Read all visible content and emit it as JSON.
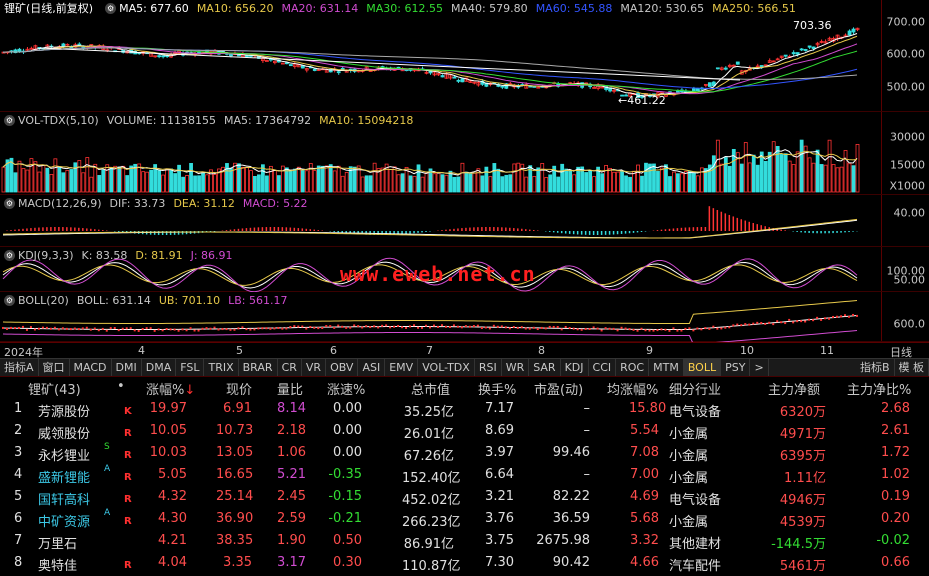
{
  "stock_title": "锂矿(日线,前复权)",
  "ma_legend": [
    {
      "label": "MA5: 677.60",
      "color": "#ffffff"
    },
    {
      "label": "MA10: 656.20",
      "color": "#e6c84a"
    },
    {
      "label": "MA20: 631.14",
      "color": "#d04cd0"
    },
    {
      "label": "MA30: 612.55",
      "color": "#33dd33"
    },
    {
      "label": "MA40: 579.80",
      "color": "#c8c8c8"
    },
    {
      "label": "MA60: 545.88",
      "color": "#3355ff"
    },
    {
      "label": "MA120: 530.65",
      "color": "#c8c8c8"
    },
    {
      "label": "MA250: 566.51",
      "color": "#e6c84a"
    }
  ],
  "price_axis": [
    "700.00",
    "600.00",
    "500.00"
  ],
  "price_high_label": "703.36",
  "price_low_label": "461.22",
  "vol_legend": [
    {
      "label": "VOL-TDX(5,10)",
      "color": "#c8c8c8"
    },
    {
      "label": "VOLUME: 11138155",
      "color": "#c8c8c8"
    },
    {
      "label": "MA5: 17364792",
      "color": "#c8c8c8"
    },
    {
      "label": "MA10: 15094218",
      "color": "#e6c84a"
    }
  ],
  "vol_axis": [
    "30000",
    "15000",
    "X1000"
  ],
  "macd_legend": [
    {
      "label": "MACD(12,26,9)",
      "color": "#c8c8c8"
    },
    {
      "label": "DIF: 33.73",
      "color": "#c8c8c8"
    },
    {
      "label": "DEA: 31.12",
      "color": "#e6c84a"
    },
    {
      "label": "MACD: 5.22",
      "color": "#d04cd0"
    }
  ],
  "macd_axis": [
    "40.00"
  ],
  "kdj_legend": [
    {
      "label": "KDJ(9,3,3)",
      "color": "#c8c8c8"
    },
    {
      "label": "K: 83.58",
      "color": "#c8c8c8"
    },
    {
      "label": "D: 81.91",
      "color": "#e6c84a"
    },
    {
      "label": "J: 86.91",
      "color": "#d04cd0"
    }
  ],
  "kdj_axis": [
    "100.00",
    "50.00"
  ],
  "boll_legend": [
    {
      "label": "BOLL(20)",
      "color": "#c8c8c8"
    },
    {
      "label": "BOLL: 631.14",
      "color": "#c8c8c8"
    },
    {
      "label": "UB: 701.10",
      "color": "#e6c84a"
    },
    {
      "label": "LB: 561.17",
      "color": "#d04cd0"
    }
  ],
  "boll_axis": [
    "600.0"
  ],
  "watermark": "www.eweb.net.cn",
  "x_axis": [
    {
      "label": "2024年",
      "pos": 4
    },
    {
      "label": "4",
      "pos": 138
    },
    {
      "label": "5",
      "pos": 236
    },
    {
      "label": "6",
      "pos": 330
    },
    {
      "label": "7",
      "pos": 426
    },
    {
      "label": "8",
      "pos": 538
    },
    {
      "label": "9",
      "pos": 646
    },
    {
      "label": "10",
      "pos": 740
    },
    {
      "label": "11",
      "pos": 820
    }
  ],
  "x_axis_right": "日线",
  "tabs": [
    "指标A",
    "窗口",
    "MACD",
    "DMI",
    "DMA",
    "FSL",
    "TRIX",
    "BRAR",
    "CR",
    "VR",
    "OBV",
    "ASI",
    "EMV",
    "VOL-TDX",
    "RSI",
    "WR",
    "SAR",
    "KDJ",
    "CCI",
    "ROC",
    "MTM",
    "BOLL",
    "PSY",
    ">"
  ],
  "tabs_right": [
    "指标B",
    "模 板"
  ],
  "table_header": {
    "name": "锂矿(43)",
    "dot": "•",
    "chg": "涨幅%",
    "price": "现价",
    "vr": "量比",
    "speed": "涨速%",
    "mcap": "总市值",
    "turnover": "换手%",
    "pe": "市盈(动)",
    "avg": "均涨幅%",
    "industry": "细分行业",
    "net": "主力净额",
    "netpct": "主力净比%"
  },
  "rows": [
    {
      "no": "1",
      "name": "芳源股份",
      "nameColor": "w",
      "sup": "",
      "flag": "K",
      "chg": "19.97",
      "price": "6.91",
      "vr": "8.14",
      "vrColor": "m",
      "speed": "0.00",
      "speedColor": "w",
      "mcap": "35.25亿",
      "turnover": "7.17",
      "pe": "–",
      "avg": "15.80",
      "industry": "电气设备",
      "net": "6320万",
      "netColor": "r",
      "netpct": "2.68",
      "netpctColor": "r"
    },
    {
      "no": "2",
      "name": "威领股份",
      "nameColor": "w",
      "sup": "",
      "flag": "R",
      "chg": "10.05",
      "price": "10.73",
      "vr": "2.18",
      "vrColor": "r",
      "speed": "0.00",
      "speedColor": "w",
      "mcap": "26.01亿",
      "turnover": "8.69",
      "pe": "–",
      "avg": "5.54",
      "industry": "小金属",
      "net": "4971万",
      "netColor": "r",
      "netpct": "2.61",
      "netpctColor": "r"
    },
    {
      "no": "3",
      "name": "永杉锂业",
      "nameColor": "w",
      "sup": "S",
      "flag": "R",
      "chg": "10.03",
      "price": "13.05",
      "vr": "1.06",
      "vrColor": "r",
      "speed": "0.00",
      "speedColor": "w",
      "mcap": "67.26亿",
      "turnover": "3.97",
      "pe": "99.46",
      "avg": "7.08",
      "industry": "小金属",
      "net": "6395万",
      "netColor": "r",
      "netpct": "1.72",
      "netpctColor": "r"
    },
    {
      "no": "4",
      "name": "盛新锂能",
      "nameColor": "c",
      "sup": "A",
      "flag": "R",
      "chg": "5.05",
      "price": "16.65",
      "vr": "5.21",
      "vrColor": "m",
      "speed": "-0.35",
      "speedColor": "g",
      "mcap": "152.40亿",
      "turnover": "6.64",
      "pe": "–",
      "avg": "7.00",
      "industry": "小金属",
      "net": "1.11亿",
      "netColor": "r",
      "netpct": "1.02",
      "netpctColor": "r"
    },
    {
      "no": "5",
      "name": "国轩高科",
      "nameColor": "c",
      "sup": "",
      "flag": "R",
      "chg": "4.32",
      "price": "25.14",
      "vr": "2.45",
      "vrColor": "r",
      "speed": "-0.15",
      "speedColor": "g",
      "mcap": "452.02亿",
      "turnover": "3.21",
      "pe": "82.22",
      "avg": "4.69",
      "industry": "电气设备",
      "net": "4946万",
      "netColor": "r",
      "netpct": "0.19",
      "netpctColor": "r"
    },
    {
      "no": "6",
      "name": "中矿资源",
      "nameColor": "c",
      "sup": "A",
      "flag": "R",
      "chg": "4.30",
      "price": "36.90",
      "vr": "2.59",
      "vrColor": "r",
      "speed": "-0.21",
      "speedColor": "g",
      "mcap": "266.23亿",
      "turnover": "3.76",
      "pe": "36.59",
      "avg": "5.68",
      "industry": "小金属",
      "net": "4539万",
      "netColor": "r",
      "netpct": "0.20",
      "netpctColor": "r"
    },
    {
      "no": "7",
      "name": "万里石",
      "nameColor": "w",
      "sup": "",
      "flag": "",
      "chg": "4.21",
      "price": "38.35",
      "vr": "1.90",
      "vrColor": "r",
      "speed": "0.50",
      "speedColor": "r",
      "mcap": "86.91亿",
      "turnover": "3.75",
      "pe": "2675.98",
      "avg": "3.32",
      "industry": "其他建材",
      "net": "-144.5万",
      "netColor": "g",
      "netpct": "-0.02",
      "netpctColor": "g"
    },
    {
      "no": "8",
      "name": "奥特佳",
      "nameColor": "w",
      "sup": "",
      "flag": "R",
      "chg": "4.04",
      "price": "3.35",
      "vr": "3.17",
      "vrColor": "m",
      "speed": "0.30",
      "speedColor": "r",
      "mcap": "110.87亿",
      "turnover": "7.30",
      "pe": "90.42",
      "avg": "4.66",
      "industry": "汽车配件",
      "net": "5461万",
      "netColor": "r",
      "netpct": "0.66",
      "netpctColor": "r"
    }
  ],
  "colors": {
    "up": "#ff4d4d",
    "down": "#33dd33",
    "bg": "#000000"
  }
}
